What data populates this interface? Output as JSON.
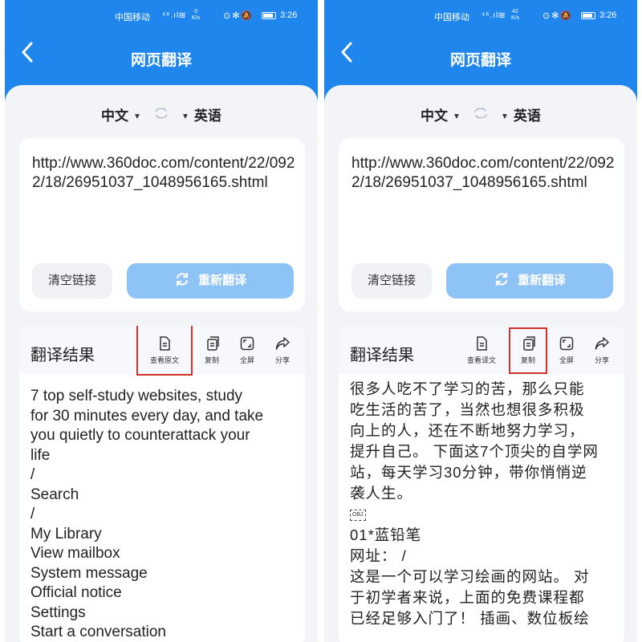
{
  "status": {
    "carrier": "中国移动",
    "signal": "⁴⁶.ıl",
    "speed_left": "0\nK/s",
    "speed_right": "42\nK/s",
    "time": "3:26"
  },
  "header": {
    "title": "网页翻译"
  },
  "languages": {
    "source": "中文",
    "target": "英语"
  },
  "url_card": {
    "url": "http://www.360doc.com/content/22/0922/18/26951037_1048956165.shtml",
    "clear_label": "清空链接",
    "retranslate_label": "重新翻译"
  },
  "left_screen": {
    "result_title": "翻译结果",
    "tools": [
      {
        "label": "查看原文",
        "icon": "document-icon"
      },
      {
        "label": "复制",
        "icon": "copy-icon"
      },
      {
        "label": "全屏",
        "icon": "fullscreen-icon"
      },
      {
        "label": "分享",
        "icon": "share-icon"
      }
    ],
    "result_lines": [
      "7 top self-study websites, study",
      "for 30 minutes every day, and take",
      "you quietly to counterattack your",
      "life",
      "/",
      "Search",
      "/",
      "My Library",
      "View mailbox",
      "System message",
      "Official notice",
      "Settings",
      "Start a conversation"
    ]
  },
  "right_screen": {
    "result_title": "翻译结果",
    "tools": [
      {
        "label": "查看译文",
        "icon": "document-icon"
      },
      {
        "label": "复制",
        "icon": "copy-icon"
      },
      {
        "label": "全屏",
        "icon": "fullscreen-icon"
      },
      {
        "label": "分享",
        "icon": "share-icon"
      }
    ],
    "result_lines": [
      "很多人吃不了学习的苦，那么只能",
      "吃生活的苦了，当然也想很多积极",
      "向上的人，还在不断地努力学习，",
      "提升自己。 下面这7个顶尖的自学网",
      "站，每天学习30分钟，带你悄悄逆",
      "袭人生。",
      "OBJ",
      "01*蓝铅笔",
      "网址：  /",
      "这是一个可以学习绘画的网站。 对",
      "于初学者来说，上面的免费课程都",
      "已经足够入门了！ 插画、数位板绘"
    ]
  },
  "colors": {
    "header_blue": "#1f86ee",
    "button_blue": "#8ec3f6",
    "highlight_red": "#d2302b"
  }
}
